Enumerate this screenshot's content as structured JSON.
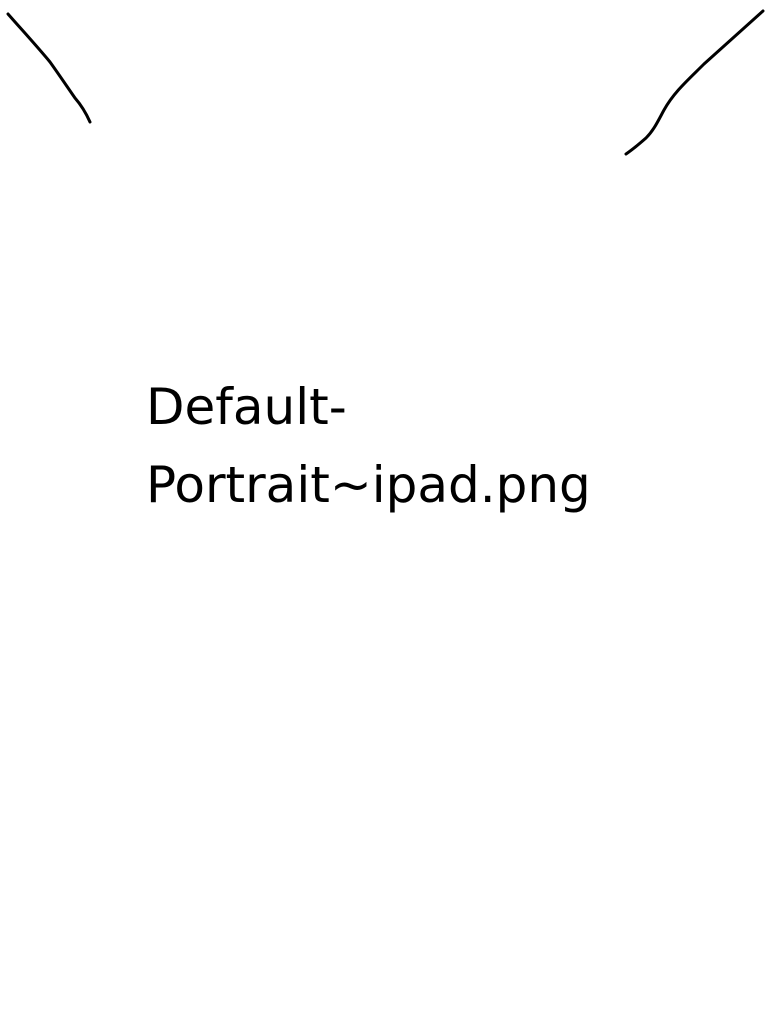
{
  "label": {
    "line1": "Default-",
    "line2": "Portrait~ipad.png"
  }
}
